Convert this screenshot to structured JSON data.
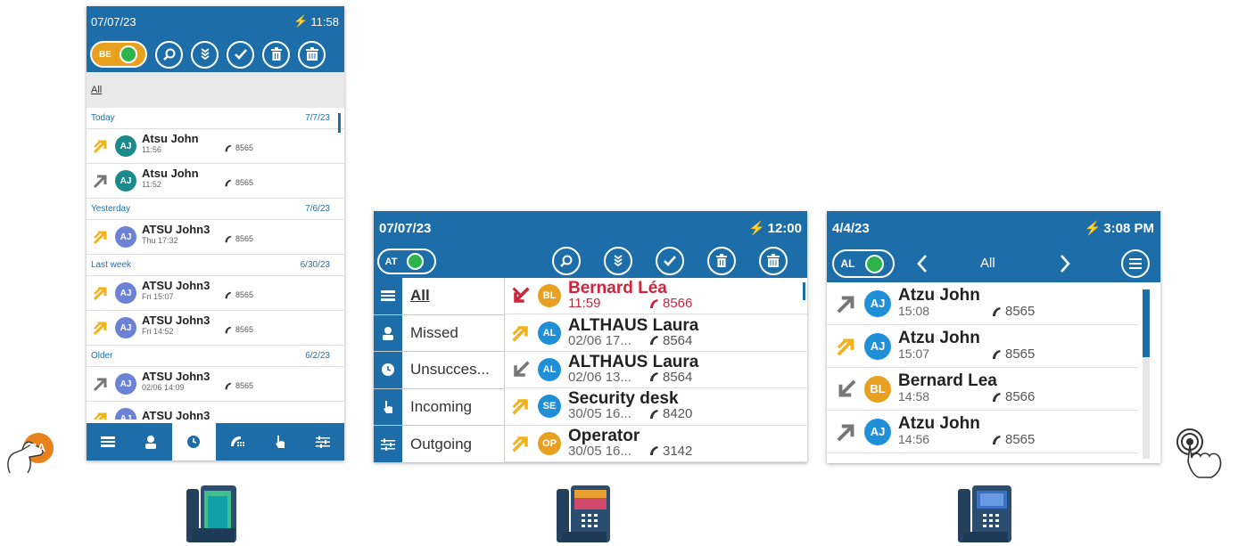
{
  "screen1": {
    "date": "07/07/23",
    "time": "11:58",
    "toggle_initials": "BE",
    "filter": "All",
    "sections": [
      {
        "label": "Today",
        "date": "7/7/23",
        "rows": [
          {
            "arrow": "yellow-out",
            "initials": "AJ",
            "av": "#1a8a8a",
            "name": "Atsu John",
            "sub": "11:56",
            "num": "8565"
          },
          {
            "arrow": "gray-out",
            "initials": "AJ",
            "av": "#1a8a8a",
            "name": "Atsu John",
            "sub": "11:52",
            "num": "8565"
          }
        ]
      },
      {
        "label": "Yesterday",
        "date": "7/6/23",
        "rows": [
          {
            "arrow": "yellow-out",
            "initials": "AJ",
            "av": "#6b82d6",
            "name": "ATSU John3",
            "sub": "Thu 17:32",
            "num": "8565"
          }
        ]
      },
      {
        "label": "Last week",
        "date": "6/30/23",
        "rows": [
          {
            "arrow": "yellow-out",
            "initials": "AJ",
            "av": "#6b82d6",
            "name": "ATSU John3",
            "sub": "Fri 15:07",
            "num": "8565"
          },
          {
            "arrow": "yellow-out",
            "initials": "AJ",
            "av": "#6b82d6",
            "name": "ATSU John3",
            "sub": "Fri 14:52",
            "num": "8565"
          }
        ]
      },
      {
        "label": "Older",
        "date": "6/2/23",
        "rows": [
          {
            "arrow": "gray-out",
            "initials": "AJ",
            "av": "#6b82d6",
            "name": "ATSU John3",
            "sub": "02/06 14:09",
            "num": "8565"
          },
          {
            "arrow": "yellow-out",
            "initials": "AJ",
            "av": "#6b82d6",
            "name": "ATSU John3",
            "sub": "",
            "num": ""
          }
        ]
      }
    ],
    "icons": [
      "search-icon",
      "filter-down-icon",
      "check-icon",
      "delete-icon",
      "delete-all-icon"
    ],
    "bottom_nav": [
      "menu-icon",
      "contact-icon",
      "history-icon",
      "dialpad-icon",
      "gesture-icon",
      "settings-icon"
    ]
  },
  "screen2": {
    "date": "07/07/23",
    "time": "12:00",
    "toggle_initials": "AT",
    "nav": [
      {
        "icon": "menu-icon",
        "label": "All"
      },
      {
        "icon": "contact-icon",
        "label": "Missed"
      },
      {
        "icon": "history-icon",
        "label": "Unsucces..."
      },
      {
        "icon": "gesture-icon",
        "label": "Incoming"
      },
      {
        "icon": "settings-icon",
        "label": "Outgoing"
      }
    ],
    "rows": [
      {
        "arrow": "red-missed",
        "initials": "BL",
        "av": "#e8a020",
        "name": "Bernard Léa",
        "sub": "11:59",
        "num": "8566",
        "missed": true
      },
      {
        "arrow": "yellow-out",
        "initials": "AL",
        "av": "#1f8fd8",
        "name": "ALTHAUS Laura",
        "sub": "02/06 17...",
        "num": "8564"
      },
      {
        "arrow": "gray-in",
        "initials": "AL",
        "av": "#1f8fd8",
        "name": "ALTHAUS Laura",
        "sub": "02/06 13...",
        "num": "8564"
      },
      {
        "arrow": "yellow-out",
        "initials": "SE",
        "av": "#1f8fd8",
        "name": "Security desk",
        "sub": "30/05 16...",
        "num": "8420"
      },
      {
        "arrow": "yellow-out",
        "initials": "OP",
        "av": "#e8a020",
        "name": "Operator",
        "sub": "30/05 16...",
        "num": "3142"
      }
    ],
    "icons": [
      "search-icon",
      "filter-down-icon",
      "check-icon",
      "delete-icon",
      "delete-all-icon"
    ]
  },
  "screen3": {
    "date": "4/4/23",
    "time": "3:08 PM",
    "toggle_initials": "AL",
    "filter": "All",
    "rows": [
      {
        "arrow": "gray-out",
        "initials": "AJ",
        "av": "#1f8fd8",
        "name": "Atzu John",
        "sub": "15:08",
        "num": "8565"
      },
      {
        "arrow": "yellow-out",
        "initials": "AJ",
        "av": "#1f8fd8",
        "name": "Atzu John",
        "sub": "15:07",
        "num": "8565"
      },
      {
        "arrow": "gray-in",
        "initials": "BL",
        "av": "#e8a020",
        "name": "Bernard Lea",
        "sub": "14:58",
        "num": "8566"
      },
      {
        "arrow": "gray-out",
        "initials": "AJ",
        "av": "#1f8fd8",
        "name": "Atzu John",
        "sub": "14:56",
        "num": "8565"
      }
    ]
  },
  "decor": {
    "hand_left_initials": "SA",
    "colors": {
      "primary": "#1d6ea8",
      "missed": "#d0243c",
      "outgoing_arrow": "#f2b21b",
      "neutral_arrow": "#777777",
      "presence": "#2cb34a"
    }
  }
}
